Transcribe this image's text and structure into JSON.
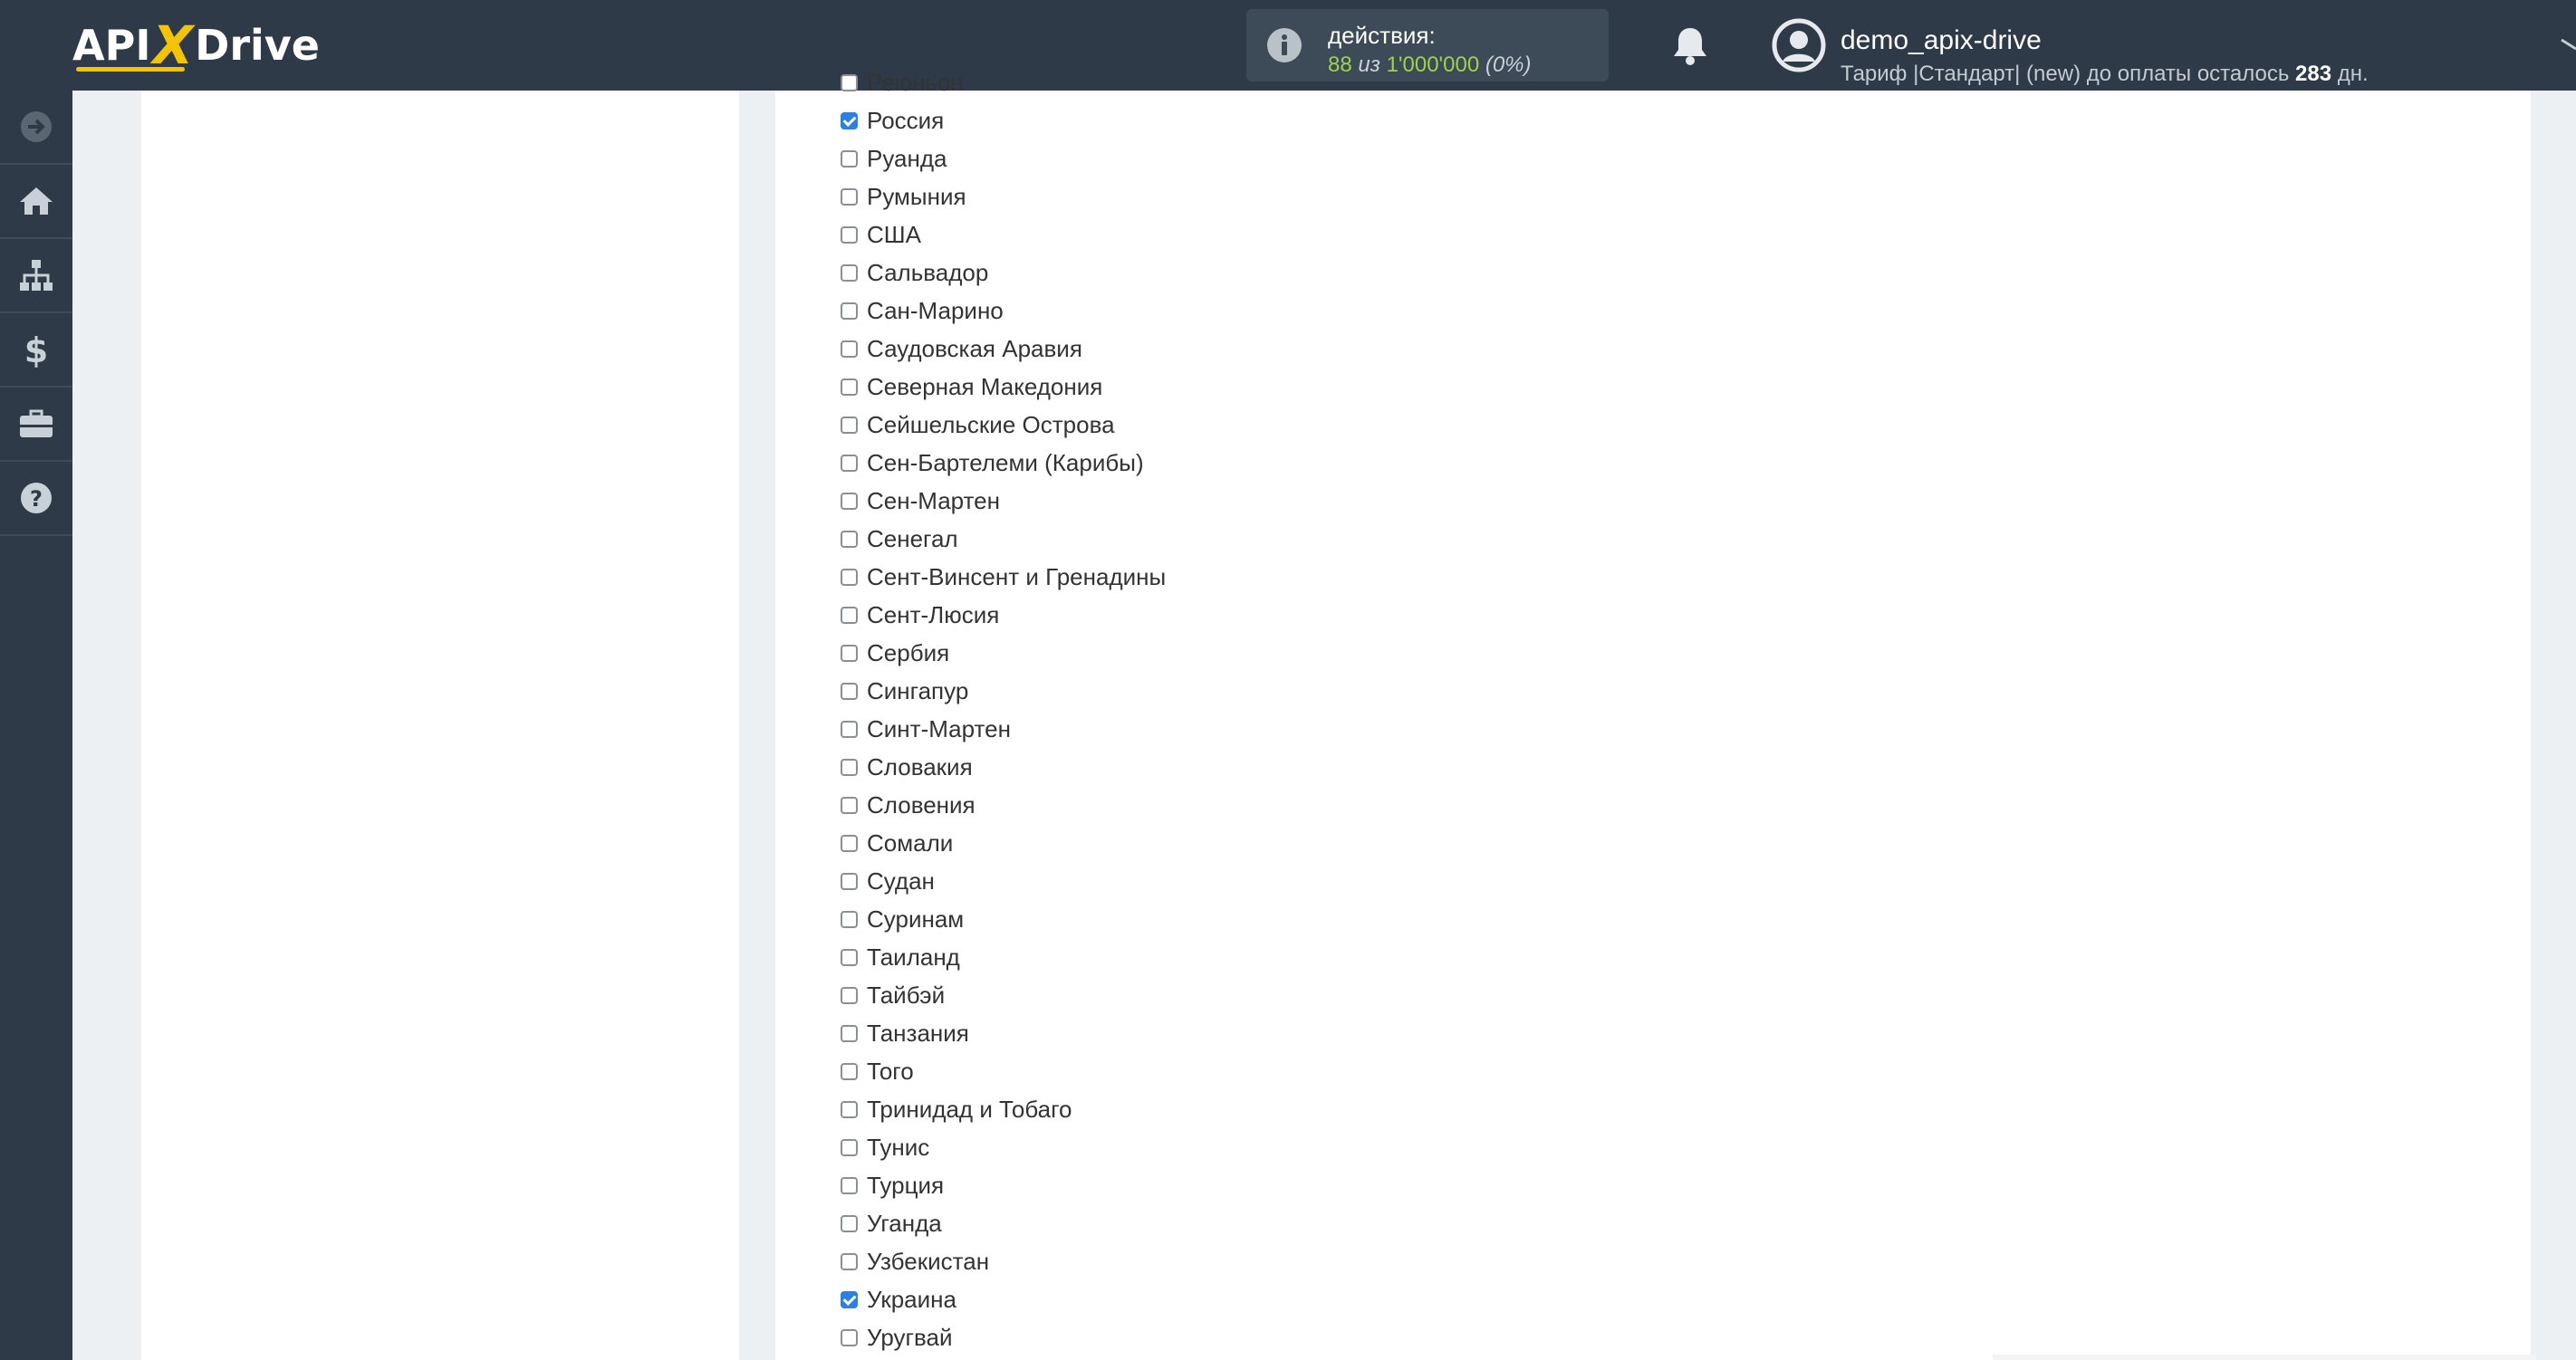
{
  "header": {
    "logo": {
      "part1": "API",
      "x": "X",
      "part2": "Drive"
    },
    "actions": {
      "label": "действия:",
      "used": "88",
      "of": "из",
      "limit": "1'000'000",
      "percent": "(0%)"
    },
    "user": {
      "name": "demo_apix-drive",
      "plan_prefix": "Тариф |Стандарт| (new) до оплаты осталось",
      "days": "283",
      "days_suffix": "дн."
    }
  },
  "sidebar": {
    "items": [
      {
        "icon": "arrow-circle-right-icon"
      },
      {
        "icon": "home-icon"
      },
      {
        "icon": "sitemap-icon"
      },
      {
        "icon": "dollar-icon"
      },
      {
        "icon": "briefcase-icon"
      },
      {
        "icon": "question-circle-icon"
      }
    ]
  },
  "countries": [
    {
      "label": "Реюньон",
      "checked": false
    },
    {
      "label": "Россия",
      "checked": true
    },
    {
      "label": "Руанда",
      "checked": false
    },
    {
      "label": "Румыния",
      "checked": false
    },
    {
      "label": "США",
      "checked": false
    },
    {
      "label": "Сальвадор",
      "checked": false
    },
    {
      "label": "Сан-Марино",
      "checked": false
    },
    {
      "label": "Саудовская Аравия",
      "checked": false
    },
    {
      "label": "Северная Македония",
      "checked": false
    },
    {
      "label": "Сейшельские Острова",
      "checked": false
    },
    {
      "label": "Сен-Бартелеми (Карибы)",
      "checked": false
    },
    {
      "label": "Сен-Мартен",
      "checked": false
    },
    {
      "label": "Сенегал",
      "checked": false
    },
    {
      "label": "Сент-Винсент и Гренадины",
      "checked": false
    },
    {
      "label": "Сент-Люсия",
      "checked": false
    },
    {
      "label": "Сербия",
      "checked": false
    },
    {
      "label": "Сингапур",
      "checked": false
    },
    {
      "label": "Синт-Мартен",
      "checked": false
    },
    {
      "label": "Словакия",
      "checked": false
    },
    {
      "label": "Словения",
      "checked": false
    },
    {
      "label": "Сомали",
      "checked": false
    },
    {
      "label": "Судан",
      "checked": false
    },
    {
      "label": "Суринам",
      "checked": false
    },
    {
      "label": "Таиланд",
      "checked": false
    },
    {
      "label": "Тайбэй",
      "checked": false
    },
    {
      "label": "Танзания",
      "checked": false
    },
    {
      "label": "Того",
      "checked": false
    },
    {
      "label": "Тринидад и Тобаго",
      "checked": false
    },
    {
      "label": "Тунис",
      "checked": false
    },
    {
      "label": "Турция",
      "checked": false
    },
    {
      "label": "Уганда",
      "checked": false
    },
    {
      "label": "Узбекистан",
      "checked": false
    },
    {
      "label": "Украина",
      "checked": true
    },
    {
      "label": "Уругвай",
      "checked": false
    }
  ],
  "colors": {
    "topbar": "#2e3a47",
    "accent": "#f5c400",
    "checkbox_checked": "#2f7fe0",
    "actions_value": "#9fd14a"
  }
}
